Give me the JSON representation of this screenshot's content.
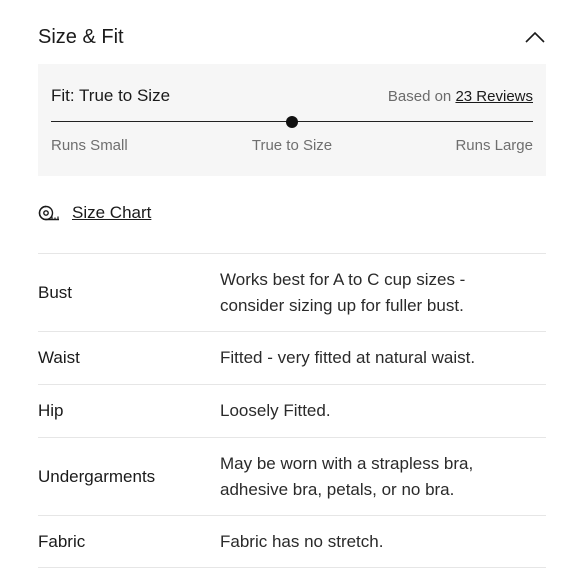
{
  "section": {
    "title": "Size & Fit",
    "toggle_icon": "chevron-up-icon"
  },
  "fit": {
    "label": "Fit: True to Size",
    "based_on": "Based on",
    "reviews_link": "23 Reviews",
    "position": 0.5,
    "scale": {
      "small": "Runs Small",
      "true": "True to Size",
      "large": "Runs Large"
    }
  },
  "size_chart": {
    "label": "Size Chart",
    "icon": "measuring-tape-icon"
  },
  "rows": [
    {
      "name": "Bust",
      "desc": [
        "Works best for A to C cup sizes -",
        "consider sizing up for fuller bust."
      ]
    },
    {
      "name": "Waist",
      "desc": [
        "Fitted - very fitted at natural waist."
      ]
    },
    {
      "name": "Hip",
      "desc": [
        "Loosely Fitted."
      ]
    },
    {
      "name": "Undergarments",
      "desc": [
        "May be worn with a strapless bra,",
        "adhesive bra, petals, or no bra."
      ]
    },
    {
      "name": "Fabric",
      "desc": [
        "Fabric has no stretch."
      ]
    }
  ]
}
